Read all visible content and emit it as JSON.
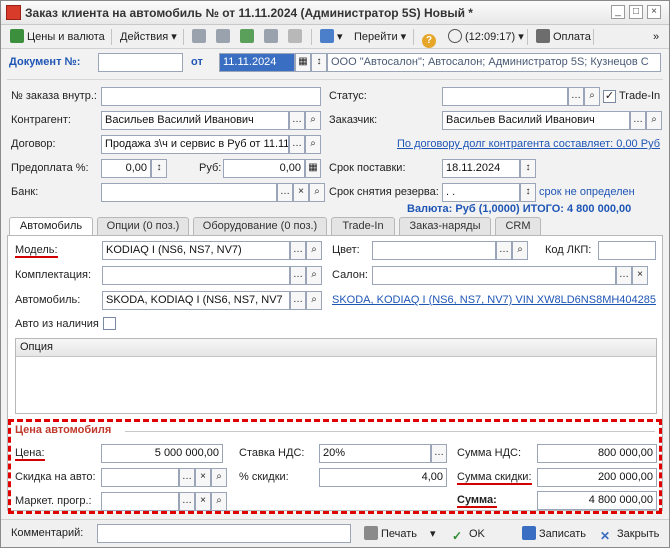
{
  "titlebar": {
    "title": "Заказ клиента на автомобиль №  от 11.11.2024 (Администратор 5S) Новый *"
  },
  "toolbar": {
    "prices_currency": "Цены и валюта",
    "actions": "Действия",
    "goto": "Перейти",
    "time": "(12:09:17)",
    "payment": "Оплата"
  },
  "header": {
    "document_label": "Документ №:",
    "document_value": "",
    "from_label": "от",
    "date_value": "11.11.2024",
    "org_value": "ООО \"Автосалон\"; Автосалон; Администратор 5S; Кузнецов С"
  },
  "form": {
    "internal_order_label": "№ заказа внутр.:",
    "internal_order_value": "",
    "status_label": "Статус:",
    "status_value": "",
    "tradein_label": "Trade-In",
    "tradein_checked": true,
    "counterparty_label": "Контрагент:",
    "counterparty_value": "Васильев Василий Иванович",
    "customer_label": "Заказчик:",
    "customer_value": "Васильев Василий Иванович",
    "contract_label": "Договор:",
    "contract_value": "Продажа з\\ч и сервис в Руб от 11.11.",
    "debt_link": "По договору долг контрагента составляет: 0,00 Руб",
    "prepay_label": "Предоплата %:",
    "prepay_value": "0,00",
    "rub_label": "Руб:",
    "rub_value": "0,00",
    "delivery_label": "Срок поставки:",
    "delivery_value": "18.11.2024",
    "bank_label": "Банк:",
    "bank_value": "",
    "reserve_label": "Срок снятия резерва:",
    "reserve_value": " .  .",
    "reserve_note": "срок не определен",
    "currency_total": "Валюта: Руб (1,0000) ИТОГО: 4 800 000,00"
  },
  "tabs": [
    "Автомобиль",
    "Опции (0 поз.)",
    "Оборудование (0 поз.)",
    "Trade-In",
    "Заказ-наряды",
    "CRM"
  ],
  "car": {
    "model_label": "Модель:",
    "model_value": "KODIAQ I (NS6, NS7, NV7)",
    "color_label": "Цвет:",
    "color_value": "",
    "pkp_label": "Код ЛКП:",
    "pkp_value": "",
    "equipment_label": "Комплектация:",
    "equipment_value": "",
    "salon_label": "Салон:",
    "salon_value": "",
    "auto_label": "Автомобиль:",
    "auto_value": "SKODA, KODIAQ I (NS6, NS7, NV7",
    "auto_link": "SKODA, KODIAQ I (NS6, NS7, NV7) VIN XW8LD6NS8MH404285",
    "instock_label": "Авто из наличия",
    "options_header": "Опция"
  },
  "price": {
    "group_title": "Цена автомобиля",
    "price_label": "Цена:",
    "price_value": "5 000 000,00",
    "vat_rate_label": "Ставка НДС:",
    "vat_rate_value": "20%",
    "vat_sum_label": "Сумма НДС:",
    "vat_sum_value": "800 000,00",
    "discount_label": "Скидка на авто:",
    "discount_value": "",
    "discount_pct_label": "% скидки:",
    "discount_pct_value": "4,00",
    "discount_sum_label": "Сумма скидки:",
    "discount_sum_value": "200 000,00",
    "marketing_label": "Маркет. прогр.:",
    "marketing_value": "",
    "total_label": "Сумма:",
    "total_value": "4 800 000,00"
  },
  "footer": {
    "comment_label": "Комментарий:",
    "comment_value": "",
    "print": "Печать",
    "ok": "OK",
    "save": "Записать",
    "close": "Закрыть"
  },
  "colors": {
    "accent_red": "#e00000",
    "link_blue": "#1f56b5",
    "group_title": "#c0392b"
  }
}
